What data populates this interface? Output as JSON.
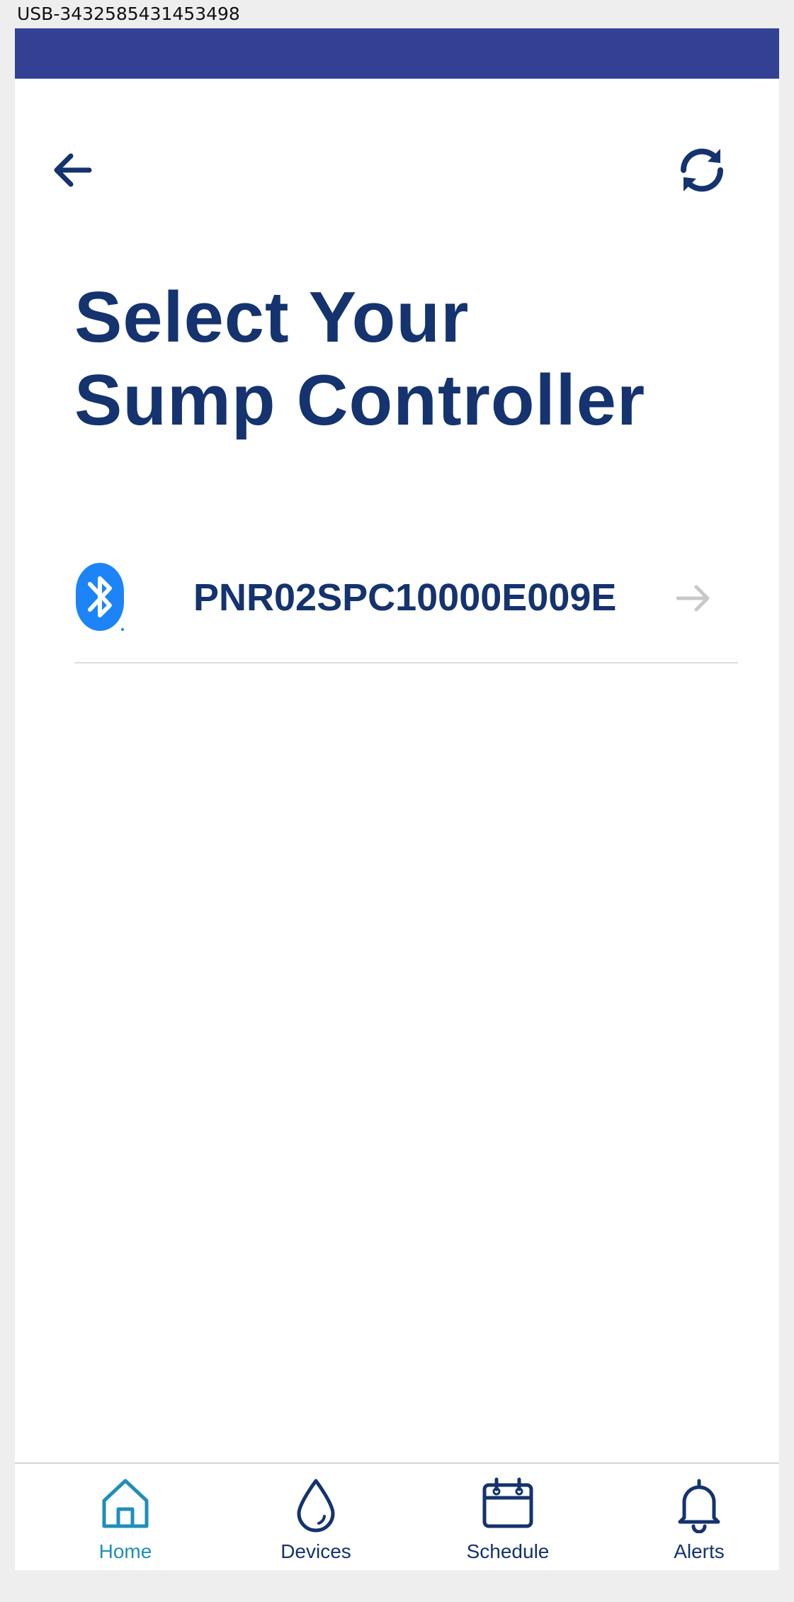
{
  "window": {
    "title": "USB-3432585431453498"
  },
  "colors": {
    "status_bar": "#334194",
    "primary_text": "#14336f",
    "accent_active_tab": "#1f8fb8",
    "bluetooth_blue": "#1c84f7",
    "arrow_inactive": "#c8c8c8"
  },
  "header": {
    "back_icon": "arrow-left-icon",
    "refresh_icon": "refresh-icon"
  },
  "page": {
    "title_line1": "Select Your",
    "title_line2": "Sump Controller"
  },
  "devices": [
    {
      "icon": "bluetooth-icon",
      "name": "PNR02SPC10000E009E",
      "action_icon": "arrow-right-icon"
    }
  ],
  "tabs": [
    {
      "label": "Home",
      "icon": "home-icon",
      "active": true
    },
    {
      "label": "Devices",
      "icon": "water-drop-icon",
      "active": false
    },
    {
      "label": "Schedule",
      "icon": "calendar-icon",
      "active": false
    },
    {
      "label": "Alerts",
      "icon": "bell-icon",
      "active": false
    }
  ]
}
